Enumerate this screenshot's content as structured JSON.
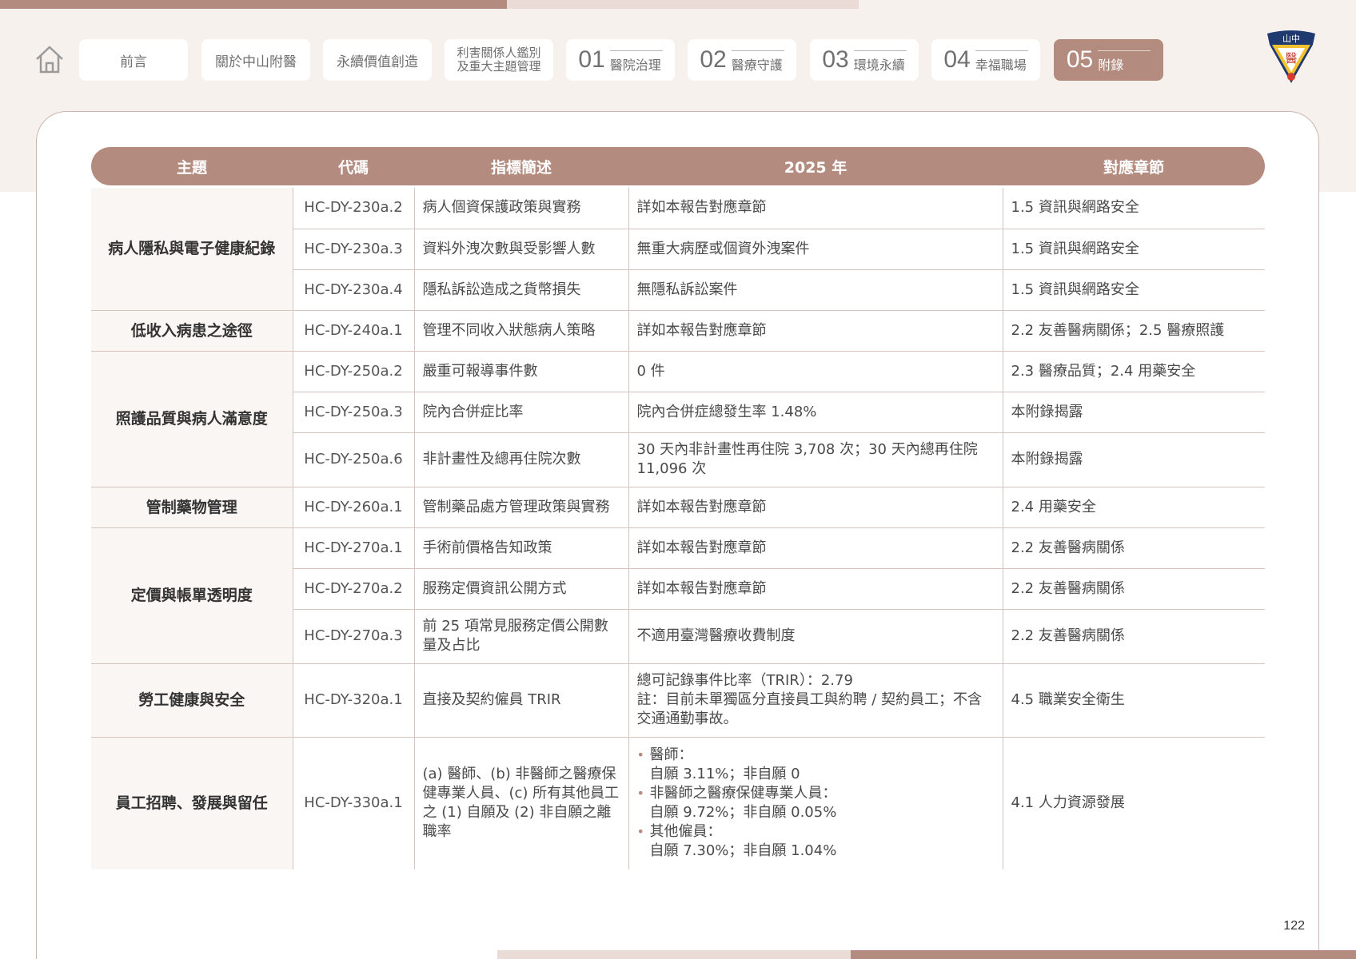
{
  "nav": {
    "items": [
      {
        "label": "前言"
      },
      {
        "label": "關於中山附醫"
      },
      {
        "label": "永續價值創造"
      },
      {
        "label_line1": "利害關係人鑑別",
        "label_line2": "及重大主題管理"
      },
      {
        "num": "01",
        "label": "醫院治理"
      },
      {
        "num": "02",
        "label": "醫療守護"
      },
      {
        "num": "03",
        "label": "環境永續"
      },
      {
        "num": "04",
        "label": "幸福職場"
      },
      {
        "num": "05",
        "label": "附錄"
      }
    ]
  },
  "logo": {
    "chars": "山中",
    "body": "醫"
  },
  "table": {
    "headers": [
      "主題",
      "代碼",
      "指標簡述",
      "2025 年",
      "對應章節"
    ],
    "topics": [
      "病人隱私與電子健康紀錄",
      "低收入病患之途徑",
      "照護品質與病人滿意度",
      "管制藥物管理",
      "定價與帳單透明度",
      "勞工健康與安全",
      "員工招聘、發展與留任"
    ],
    "rows": [
      {
        "code": "HC-DY-230a.2",
        "desc": "病人個資保護政策與實務",
        "value": "詳如本報告對應章節",
        "chapter": "1.5 資訊與網路安全"
      },
      {
        "code": "HC-DY-230a.3",
        "desc": "資料外洩次數與受影響人數",
        "value": "無重大病歷或個資外洩案件",
        "chapter": "1.5 資訊與網路安全"
      },
      {
        "code": "HC-DY-230a.4",
        "desc": "隱私訴訟造成之貨幣損失",
        "value": "無隱私訴訟案件",
        "chapter": "1.5 資訊與網路安全"
      },
      {
        "code": "HC-DY-240a.1",
        "desc": "管理不同收入狀態病人策略",
        "value": "詳如本報告對應章節",
        "chapter": "2.2 友善醫病關係；2.5 醫療照護"
      },
      {
        "code": "HC-DY-250a.2",
        "desc": "嚴重可報導事件數",
        "value": "0 件",
        "chapter": "2.3 醫療品質；2.4 用藥安全"
      },
      {
        "code": "HC-DY-250a.3",
        "desc": "院內合併症比率",
        "value": "院內合併症總發生率 1.48%",
        "chapter": "本附錄揭露"
      },
      {
        "code": "HC-DY-250a.6",
        "desc": "非計畫性及總再住院次數",
        "value": "30 天內非計畫性再住院 3,708 次；30 天內總再住院 11,096 次",
        "chapter": "本附錄揭露"
      },
      {
        "code": "HC-DY-260a.1",
        "desc": "管制藥品處方管理政策與實務",
        "value": "詳如本報告對應章節",
        "chapter": "2.4 用藥安全"
      },
      {
        "code": "HC-DY-270a.1",
        "desc": "手術前價格告知政策",
        "value": "詳如本報告對應章節",
        "chapter": "2.2 友善醫病關係"
      },
      {
        "code": "HC-DY-270a.2",
        "desc": "服務定價資訊公開方式",
        "value": "詳如本報告對應章節",
        "chapter": "2.2 友善醫病關係"
      },
      {
        "code": "HC-DY-270a.3",
        "desc": "前 25 項常見服務定價公開數量及占比",
        "value": "不適用臺灣醫療收費制度",
        "chapter": "2.2 友善醫病關係"
      },
      {
        "code": "HC-DY-320a.1",
        "desc": "直接及契約僱員 TRIR",
        "value_line1": "總可記錄事件比率（TRIR）：2.79",
        "value_line2": "註：目前未單獨區分直接員工與約聘 / 契約員工；不含交通通勤事故。",
        "chapter": "4.5 職業安全衛生"
      },
      {
        "code": "HC-DY-330a.1",
        "desc": "(a) 醫師、(b) 非醫師之醫療保健專業人員、(c) 所有其他員工之 (1) 自願及 (2) 非自願之離職率",
        "bullets": [
          {
            "title": "醫師：",
            "detail": "自願 3.11%；非自願 0"
          },
          {
            "title": "非醫師之醫療保健專業人員：",
            "detail": "自願 9.72%；非自願 0.05%"
          },
          {
            "title": "其他僱員：",
            "detail": "自願 7.30%；非自願 1.04%"
          }
        ],
        "chapter": "4.1 人力資源發展"
      }
    ]
  },
  "page_number": "122",
  "colors": {
    "accent": "#b48b7f",
    "band": "#f7f1ee",
    "light": "#eadbd6"
  }
}
